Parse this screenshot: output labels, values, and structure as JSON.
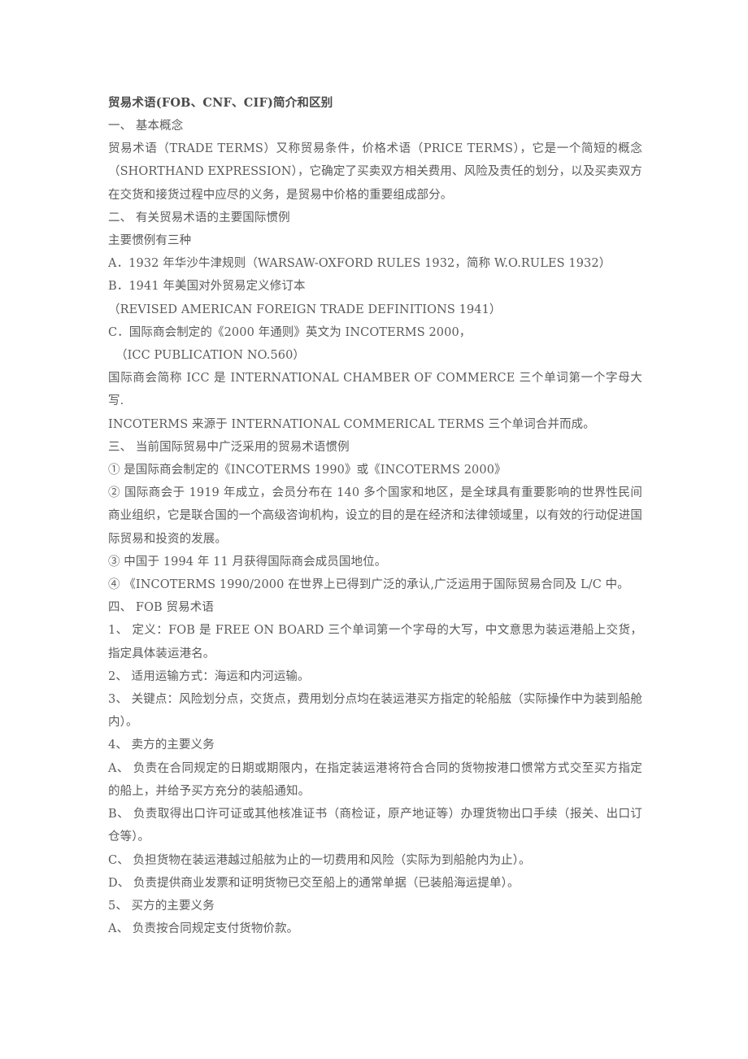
{
  "document": {
    "title": "贸易术语(FOB、CNF、CIF)简介和区别",
    "background_color": "#ffffff",
    "text_color": "#5a5a5a",
    "title_color": "#4a4a4a",
    "sections": [
      {
        "heading": "一、    基本概念",
        "lines": [
          "贸易术语（TRADE  TERMS）又称贸易条件，价格术语（PRICE  TERMS），它是一个简短的概念（SHORTHAND  EXPRESSION），它确定了买卖双方相关费用、风险及责任的划分，以及买卖双方在交货和接货过程中应尽的义务，是贸易中价格的重要组成部分。"
        ]
      },
      {
        "heading": "二、    有关贸易术语的主要国际惯例",
        "lines": [
          "主要惯例有三种",
          "A．1932 年华沙牛津规则（WARSAW-OXFORD  RULES  1932，简称 W.O.RULES  1932）",
          "B．1941 年美国对外贸易定义修订本",
          "（REVISED  AMERICAN  FOREIGN  TRADE  DEFINITIONS  1941）",
          "C．国际商会制定的《2000 年通则》英文为 INCOTERMS  2000，",
          "（ICC  PUBLICATION  NO.560）",
          "国际商会简称 ICC 是 INTERNATIONAL  CHAMBER  OF  COMMERCE 三个单词第一个字母大写.",
          "INCOTERMS 来源于 INTERNATIONAL  COMMERICAL  TERMS 三个单词合并而成。"
        ]
      },
      {
        "heading": "三、    当前国际贸易中广泛采用的贸易术语惯例",
        "lines": [
          "①    是国际商会制定的《INCOTERMS  1990》或《INCOTERMS  2000》",
          "②    国际商会于 1919 年成立，会员分布在 140 多个国家和地区，是全球具有重要影响的世界性民间商业组织，它是联合国的一个高级咨询机构，设立的目的是在经济和法律领域里，以有效的行动促进国际贸易和投资的发展。",
          "③    中国于 1994 年 11 月获得国际商会成员国地位。",
          "④    《INCOTERMS  1990/2000 在世界上已得到广泛的承认,广泛运用于国际贸易合同及 L/C 中。"
        ]
      },
      {
        "heading": "四、    FOB    贸易术语",
        "lines": [
          "1、    定义：FOB 是 FREE  ON  BOARD 三个单词第一个字母的大写，中文意思为装运港船上交货，指定具体装运港名。",
          "2、    适用运输方式：海运和内河运输。",
          "3、    关键点：风险划分点，交货点，费用划分点均在装运港买方指定的轮船舷（实际操作中为装到船舱内）。",
          "4、    卖方的主要义务",
          "A、    负责在合同规定的日期或期限内，在指定装运港将符合合同的货物按港口惯常方式交至买方指定的船上，并给予买方充分的装船通知。",
          "B、    负责取得出口许可证或其他核准证书（商检证，原产地证等）办理货物出口手续（报关、出口订仓等）。",
          "C、    负担货物在装运港越过船舷为止的一切费用和风险（实际为到船舱内为止）。",
          "D、    负责提供商业发票和证明货物已交至船上的通常单据（已装船海运提单）。",
          "5、    买方的主要义务",
          "A、    负责按合同规定支付货物价款。"
        ]
      }
    ]
  }
}
